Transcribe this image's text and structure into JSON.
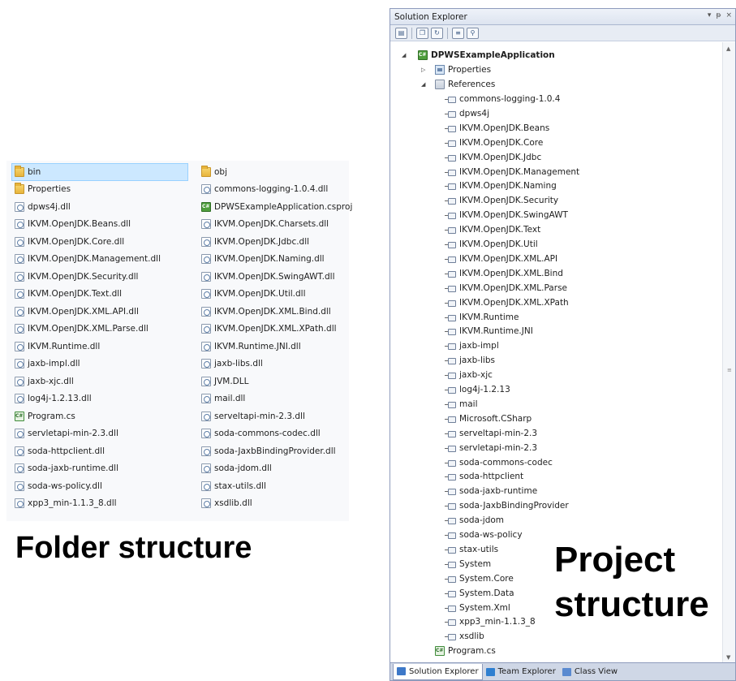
{
  "folder": {
    "column1": [
      {
        "name": "bin",
        "icon": "folder-icon",
        "selected": true
      },
      {
        "name": "Properties",
        "icon": "folder-icon"
      },
      {
        "name": "dpws4j.dll",
        "icon": "dll-icon"
      },
      {
        "name": "IKVM.OpenJDK.Beans.dll",
        "icon": "dll-icon"
      },
      {
        "name": "IKVM.OpenJDK.Core.dll",
        "icon": "dll-icon"
      },
      {
        "name": "IKVM.OpenJDK.Management.dll",
        "icon": "dll-icon"
      },
      {
        "name": "IKVM.OpenJDK.Security.dll",
        "icon": "dll-icon"
      },
      {
        "name": "IKVM.OpenJDK.Text.dll",
        "icon": "dll-icon"
      },
      {
        "name": "IKVM.OpenJDK.XML.API.dll",
        "icon": "dll-icon"
      },
      {
        "name": "IKVM.OpenJDK.XML.Parse.dll",
        "icon": "dll-icon"
      },
      {
        "name": "IKVM.Runtime.dll",
        "icon": "dll-icon"
      },
      {
        "name": "jaxb-impl.dll",
        "icon": "dll-icon"
      },
      {
        "name": "jaxb-xjc.dll",
        "icon": "dll-icon"
      },
      {
        "name": "log4j-1.2.13.dll",
        "icon": "dll-icon"
      },
      {
        "name": "Program.cs",
        "icon": "csharp-file-icon"
      },
      {
        "name": "servletapi-min-2.3.dll",
        "icon": "dll-icon"
      },
      {
        "name": "soda-httpclient.dll",
        "icon": "dll-icon"
      },
      {
        "name": "soda-jaxb-runtime.dll",
        "icon": "dll-icon"
      },
      {
        "name": "soda-ws-policy.dll",
        "icon": "dll-icon"
      },
      {
        "name": "xpp3_min-1.1.3_8.dll",
        "icon": "dll-icon"
      }
    ],
    "column2": [
      {
        "name": "obj",
        "icon": "folder-icon"
      },
      {
        "name": "commons-logging-1.0.4.dll",
        "icon": "dll-icon"
      },
      {
        "name": "DPWSExampleApplication.csproj",
        "icon": "csproj-icon"
      },
      {
        "name": "IKVM.OpenJDK.Charsets.dll",
        "icon": "dll-icon"
      },
      {
        "name": "IKVM.OpenJDK.Jdbc.dll",
        "icon": "dll-icon"
      },
      {
        "name": "IKVM.OpenJDK.Naming.dll",
        "icon": "dll-icon"
      },
      {
        "name": "IKVM.OpenJDK.SwingAWT.dll",
        "icon": "dll-icon"
      },
      {
        "name": "IKVM.OpenJDK.Util.dll",
        "icon": "dll-icon"
      },
      {
        "name": "IKVM.OpenJDK.XML.Bind.dll",
        "icon": "dll-icon"
      },
      {
        "name": "IKVM.OpenJDK.XML.XPath.dll",
        "icon": "dll-icon"
      },
      {
        "name": "IKVM.Runtime.JNI.dll",
        "icon": "dll-icon"
      },
      {
        "name": "jaxb-libs.dll",
        "icon": "dll-icon"
      },
      {
        "name": "JVM.DLL",
        "icon": "dll-icon"
      },
      {
        "name": "mail.dll",
        "icon": "dll-icon"
      },
      {
        "name": "serveltapi-min-2.3.dll",
        "icon": "dll-icon"
      },
      {
        "name": "soda-commons-codec.dll",
        "icon": "dll-icon"
      },
      {
        "name": "soda-JaxbBindingProvider.dll",
        "icon": "dll-icon"
      },
      {
        "name": "soda-jdom.dll",
        "icon": "dll-icon"
      },
      {
        "name": "stax-utils.dll",
        "icon": "dll-icon"
      },
      {
        "name": "xsdlib.dll",
        "icon": "dll-icon"
      }
    ]
  },
  "captions": {
    "folder": "Folder structure",
    "project_line1": "Project",
    "project_line2": "structure"
  },
  "solution_explorer": {
    "title": "Solution Explorer",
    "title_controls": [
      "▾",
      "ᵽ",
      "×"
    ],
    "project": "DPWSExampleApplication",
    "properties": "Properties",
    "references_label": "References",
    "references": [
      "commons-logging-1.0.4",
      "dpws4j",
      "IKVM.OpenJDK.Beans",
      "IKVM.OpenJDK.Core",
      "IKVM.OpenJDK.Jdbc",
      "IKVM.OpenJDK.Management",
      "IKVM.OpenJDK.Naming",
      "IKVM.OpenJDK.Security",
      "IKVM.OpenJDK.SwingAWT",
      "IKVM.OpenJDK.Text",
      "IKVM.OpenJDK.Util",
      "IKVM.OpenJDK.XML.API",
      "IKVM.OpenJDK.XML.Bind",
      "IKVM.OpenJDK.XML.Parse",
      "IKVM.OpenJDK.XML.XPath",
      "IKVM.Runtime",
      "IKVM.Runtime.JNI",
      "jaxb-impl",
      "jaxb-libs",
      "jaxb-xjc",
      "log4j-1.2.13",
      "mail",
      "Microsoft.CSharp",
      "serveltapi-min-2.3",
      "servletapi-min-2.3",
      "soda-commons-codec",
      "soda-httpclient",
      "soda-jaxb-runtime",
      "soda-JaxbBindingProvider",
      "soda-jdom",
      "soda-ws-policy",
      "stax-utils",
      "System",
      "System.Core",
      "System.Data",
      "System.Xml",
      "xpp3_min-1.1.3_8",
      "xsdlib"
    ],
    "program_file": "Program.cs",
    "tabs": [
      {
        "label": "Solution Explorer",
        "active": true,
        "color": "#3d78c8"
      },
      {
        "label": "Team Explorer",
        "active": false,
        "color": "#2f7fd0"
      },
      {
        "label": "Class View",
        "active": false,
        "color": "#5a8ad0"
      }
    ]
  }
}
